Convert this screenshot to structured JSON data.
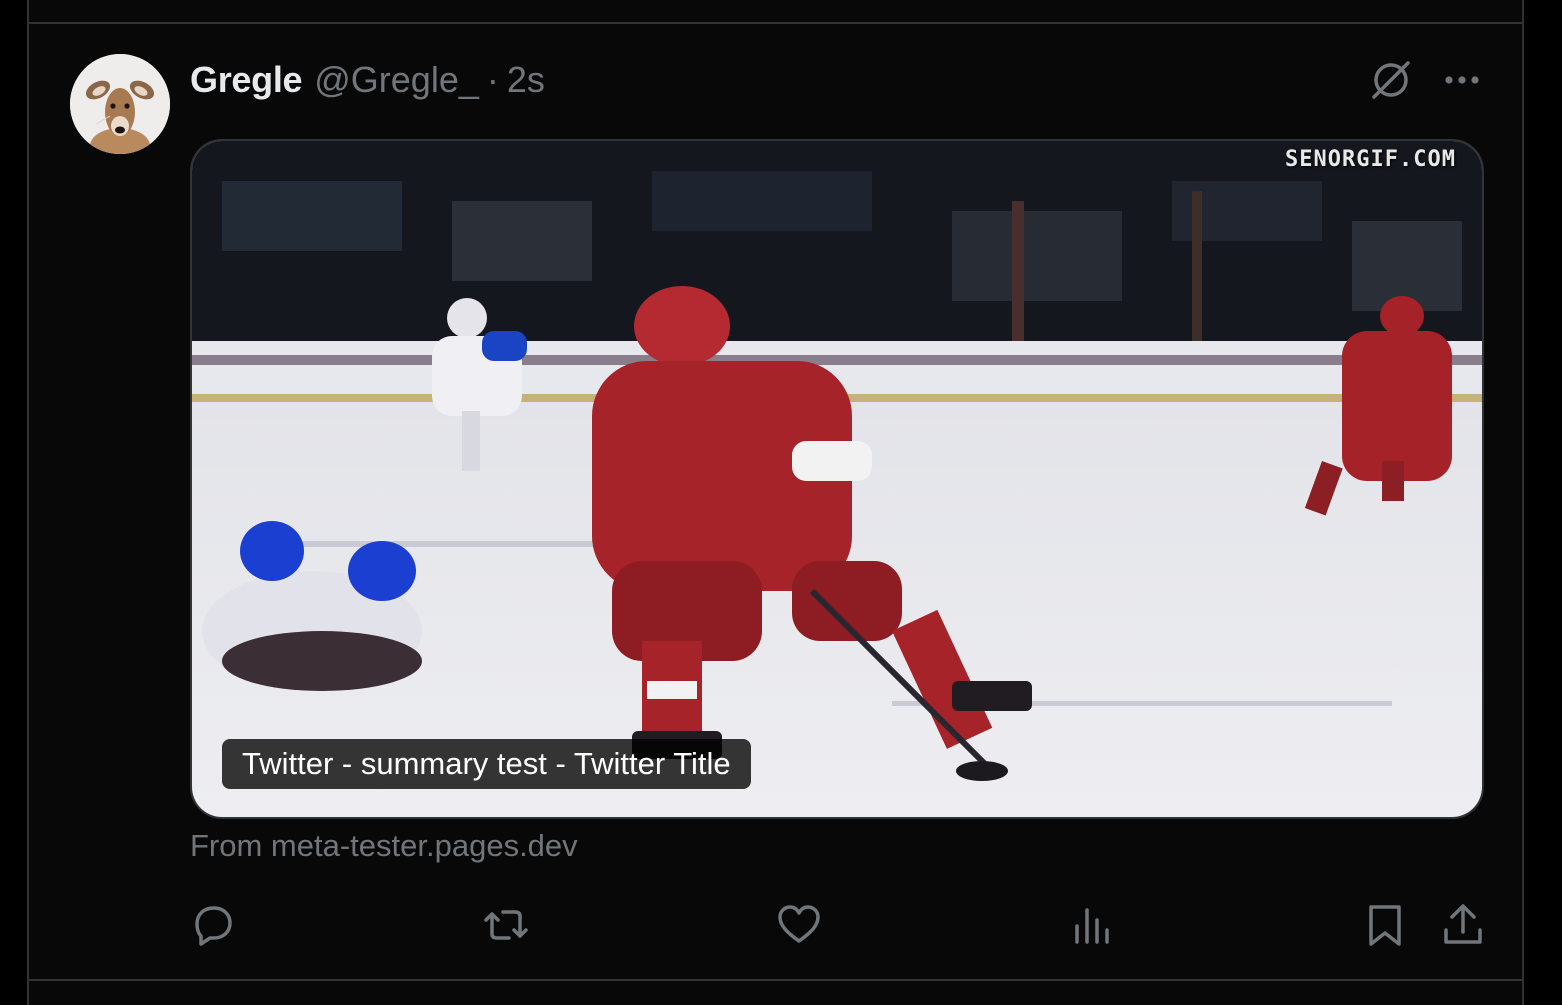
{
  "author": {
    "display_name": "Gregle",
    "handle": "@Gregle_",
    "separator": "·",
    "timestamp": "2s"
  },
  "card": {
    "watermark": "SENORGIF.COM",
    "title": "Twitter - summary test - Twitter Title",
    "source": "From meta-tester.pages.dev"
  },
  "icons": {
    "grok": "grok-icon",
    "more": "more-icon",
    "reply": "reply-icon",
    "retweet": "retweet-icon",
    "like": "heart-icon",
    "views": "views-icon",
    "bookmark": "bookmark-icon",
    "share": "share-icon"
  },
  "colors": {
    "background": "#000000",
    "text_primary": "#e7e9ea",
    "text_secondary": "#71767b",
    "border": "#2f3336"
  }
}
